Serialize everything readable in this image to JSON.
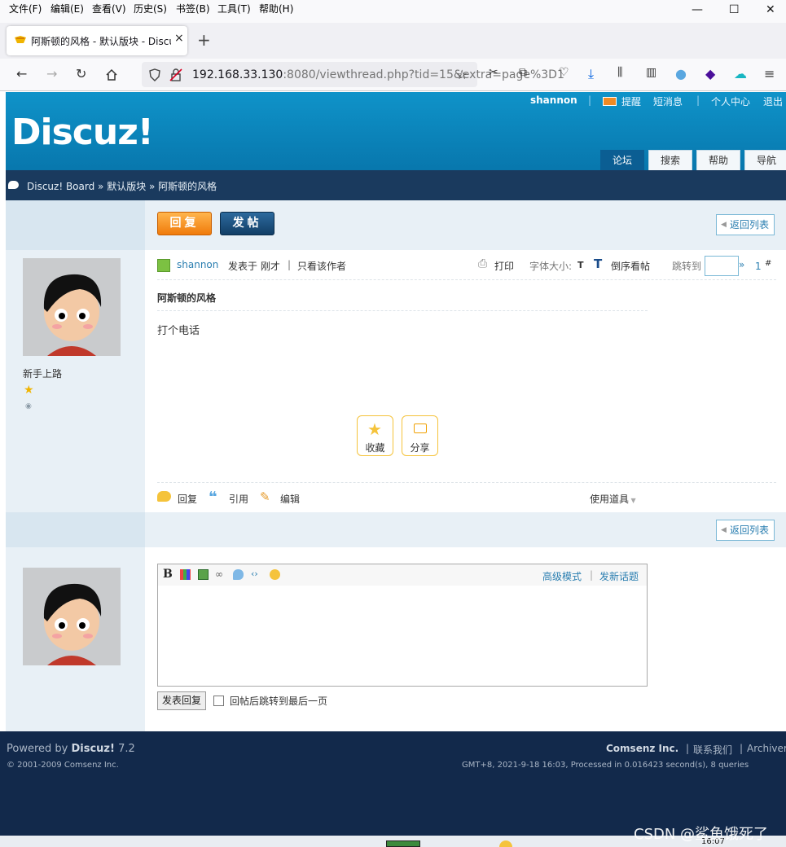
{
  "menubar": [
    "文件(F)",
    "编辑(E)",
    "查看(V)",
    "历史(S)",
    "书签(B)",
    "工具(T)",
    "帮助(H)"
  ],
  "tab": {
    "title": "阿斯顿的风格 - 默认版块 - Discuz! Board",
    "close": "×"
  },
  "newtab": "+",
  "url": {
    "host": "192.168.33.130",
    "rest": ":8080/viewthread.php?tid=15&extra=page%3D1"
  },
  "header": {
    "logo": "Discuz!",
    "username": "shannon",
    "links": [
      "提醒",
      "短消息",
      "个人中心",
      "退出"
    ],
    "nav": [
      "论坛",
      "搜索",
      "帮助",
      "导航"
    ]
  },
  "breadcrumb": "Discuz! Board » 默认版块 » 阿斯顿的风格",
  "buttons": {
    "reply": "回复",
    "post": "发帖",
    "back": "返回列表"
  },
  "post": {
    "author": "shannon",
    "posted": "发表于 刚才",
    "only_author": "只看该作者",
    "print": "打印",
    "font_size": "字体大小:",
    "t_small": "T",
    "t_big": "T",
    "reverse": "倒序看帖",
    "jump": "跳转到",
    "jump_arrow": "»",
    "floor_num": "1",
    "floor_hash": "#",
    "title": "阿斯顿的风格",
    "content": "打个电话",
    "rank": "新手上路",
    "favorite": "收藏",
    "share": "分享",
    "reply": "回复",
    "quote": "引用",
    "edit": "编辑",
    "tools": "使用道具"
  },
  "editor": {
    "bold": "B",
    "advanced": "高级模式",
    "new_topic": "发新话题",
    "submit": "发表回复",
    "jump_last": "回帖后跳转到最后一页"
  },
  "footer": {
    "powered_prefix": "Powered by ",
    "powered_name": "Discuz!",
    "powered_ver": " 7.2",
    "copyright": "© 2001-2009 Comsenz Inc.",
    "company": "Comsenz Inc.",
    "contact": "联系我们",
    "archiver": "Archiver",
    "stats": "GMT+8, 2021-9-18 16:03, Processed in 0.016423 second(s), 8 queries"
  },
  "watermark": "CSDN @鲨鱼饿死了",
  "taskbar_time": "16:07",
  "colors": {
    "header": "#0877ad",
    "crumb": "#1a3a5e",
    "footer": "#12294b",
    "link": "#2a7eb0",
    "reply_btn": "#f07b0b"
  }
}
